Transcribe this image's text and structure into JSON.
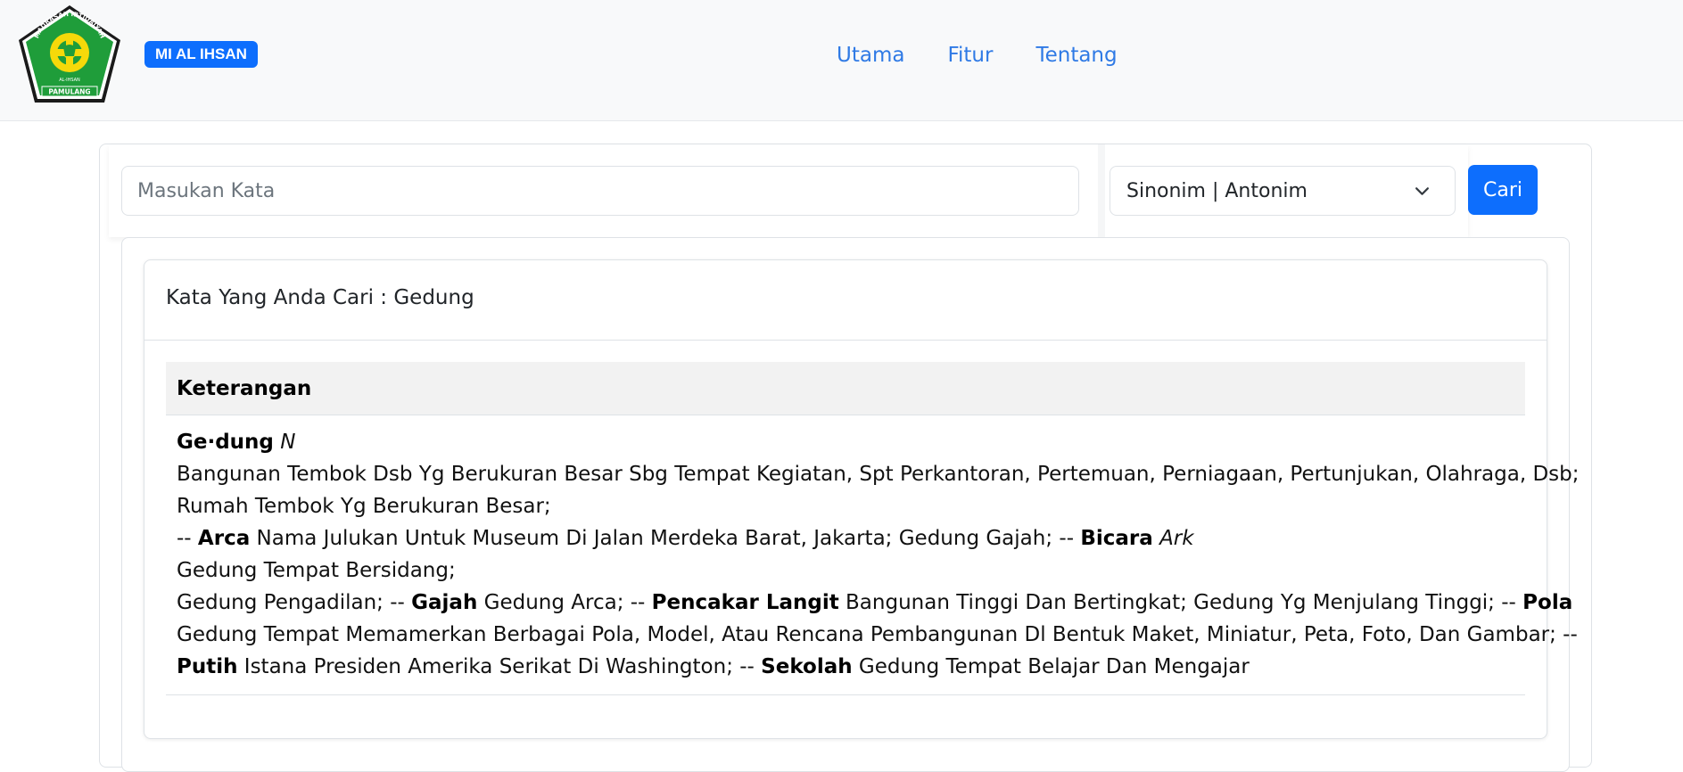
{
  "header": {
    "logo_text": {
      "top_arc": "MADRASAH IBTIDAIYAH",
      "inner": "AL-IHSAN",
      "ribbon": "PAMULANG"
    },
    "brand": "MI AL IHSAN",
    "nav": [
      {
        "label": "Utama"
      },
      {
        "label": "Fitur"
      },
      {
        "label": "Tentang"
      }
    ]
  },
  "search": {
    "placeholder": "Masukan Kata",
    "value": "",
    "mode_selected": "Sinonim | Antonim",
    "button_label": "Cari"
  },
  "result": {
    "title": "Kata Yang Anda Cari : Gedung",
    "column_header": "Keterangan",
    "entry": {
      "headword": "Ge·dung",
      "pos": "N",
      "line2": "Bangunan Tembok Dsb Yg Berukuran Besar Sbg Tempat Kegiatan, Spt Perkantoran, Pertemuan, Perniagaan, Pertunjukan, Olahraga, Dsb;",
      "line3": "Rumah Tembok Yg Berukuran Besar;",
      "line4": {
        "p1": "-- ",
        "b1": "Arca",
        "p2": " Nama Julukan Untuk Museum Di Jalan Merdeka Barat, Jakarta; Gedung Gajah; -- ",
        "b2": "Bicara",
        "p3": " ",
        "i1": "Ark"
      },
      "line5": "Gedung Tempat Bersidang;",
      "line6": {
        "p1": "Gedung Pengadilan; -- ",
        "b1": "Gajah",
        "p2": " Gedung Arca; -- ",
        "b2": "Pencakar Langit",
        "p3": " Bangunan Tinggi Dan Bertingkat; Gedung Yg Menjulang Tinggi; -- ",
        "b3": "Pola"
      },
      "line7": "Gedung Tempat Memamerkan Berbagai Pola, Model, Atau Rencana Pembangunan Dl Bentuk Maket, Miniatur, Peta, Foto, Dan Gambar; --",
      "line8": {
        "b1": "Putih",
        "p1": " Istana Presiden Amerika Serikat Di Washington; -- ",
        "b2": "Sekolah",
        "p2": " Gedung Tempat Belajar Dan Mengajar"
      }
    }
  },
  "colors": {
    "accent": "#0d6efd",
    "nav_link": "#2f7ae5",
    "logo_green": "#1f9d3a",
    "logo_yellow": "#f5d90a"
  }
}
